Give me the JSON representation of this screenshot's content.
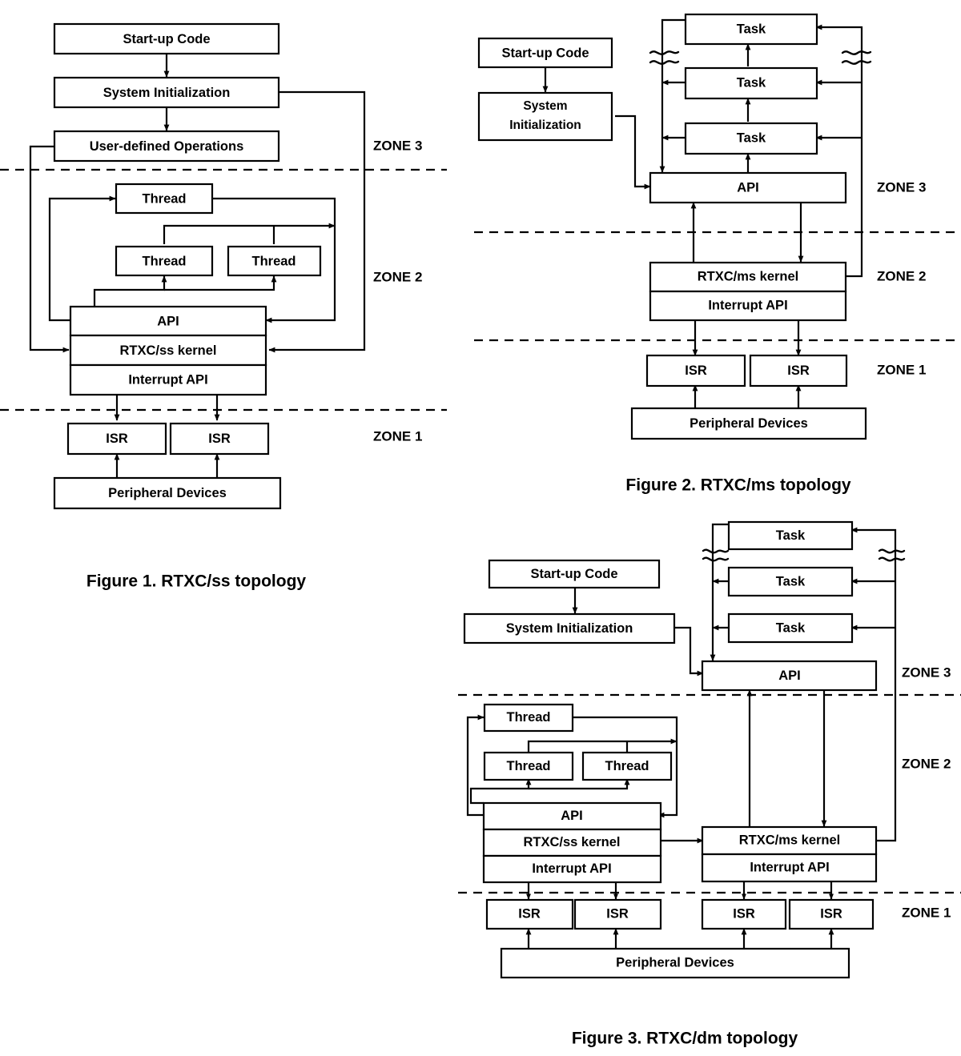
{
  "figures": [
    {
      "id": "figure-1",
      "caption": "Figure 1. RTXC/ss topology",
      "zones": [
        "ZONE 3",
        "ZONE 2",
        "ZONE 1"
      ],
      "boxes": [
        {
          "name": "startup-code",
          "label": "Start-up Code"
        },
        {
          "name": "system-initialization",
          "label": "System Initialization"
        },
        {
          "name": "user-defined-operations",
          "label": "User-defined Operations"
        },
        {
          "name": "thread-1",
          "label": "Thread"
        },
        {
          "name": "thread-2",
          "label": "Thread"
        },
        {
          "name": "thread-3",
          "label": "Thread"
        },
        {
          "name": "api",
          "label": "API"
        },
        {
          "name": "rtxc-ss-kernel",
          "label": "RTXC/ss kernel"
        },
        {
          "name": "interrupt-api",
          "label": "Interrupt API"
        },
        {
          "name": "isr-1",
          "label": "ISR"
        },
        {
          "name": "isr-2",
          "label": "ISR"
        },
        {
          "name": "peripheral-devices",
          "label": "Peripheral Devices"
        }
      ]
    },
    {
      "id": "figure-2",
      "caption": "Figure 2. RTXC/ms topology",
      "zones": [
        "ZONE 3",
        "ZONE 2",
        "ZONE 1"
      ],
      "boxes": [
        {
          "name": "startup-code",
          "label": "Start-up Code"
        },
        {
          "name": "system-initialization",
          "label": "System Initialization"
        },
        {
          "name": "task-1",
          "label": "Task"
        },
        {
          "name": "task-2",
          "label": "Task"
        },
        {
          "name": "task-3",
          "label": "Task"
        },
        {
          "name": "api",
          "label": "API"
        },
        {
          "name": "rtxc-ms-kernel",
          "label": "RTXC/ms kernel"
        },
        {
          "name": "interrupt-api",
          "label": "Interrupt API"
        },
        {
          "name": "isr-1",
          "label": "ISR"
        },
        {
          "name": "isr-2",
          "label": "ISR"
        },
        {
          "name": "peripheral-devices",
          "label": "Peripheral Devices"
        }
      ]
    },
    {
      "id": "figure-3",
      "caption": "Figure 3. RTXC/dm topology",
      "zones": [
        "ZONE 3",
        "ZONE 2",
        "ZONE 1"
      ],
      "boxes": [
        {
          "name": "startup-code",
          "label": "Start-up Code"
        },
        {
          "name": "system-initialization",
          "label": "System Initialization"
        },
        {
          "name": "task-1",
          "label": "Task"
        },
        {
          "name": "task-2",
          "label": "Task"
        },
        {
          "name": "task-3",
          "label": "Task"
        },
        {
          "name": "api-ms",
          "label": "API"
        },
        {
          "name": "thread-1",
          "label": "Thread"
        },
        {
          "name": "thread-2",
          "label": "Thread"
        },
        {
          "name": "thread-3",
          "label": "Thread"
        },
        {
          "name": "api-ss",
          "label": "API"
        },
        {
          "name": "rtxc-ss-kernel",
          "label": "RTXC/ss kernel"
        },
        {
          "name": "interrupt-api-ss",
          "label": "Interrupt API"
        },
        {
          "name": "rtxc-ms-kernel",
          "label": "RTXC/ms kernel"
        },
        {
          "name": "interrupt-api-ms",
          "label": "Interrupt API"
        },
        {
          "name": "isr-1",
          "label": "ISR"
        },
        {
          "name": "isr-2",
          "label": "ISR"
        },
        {
          "name": "isr-3",
          "label": "ISR"
        },
        {
          "name": "isr-4",
          "label": "ISR"
        },
        {
          "name": "peripheral-devices",
          "label": "Peripheral Devices"
        }
      ]
    }
  ],
  "colors": {
    "stroke": "#000000",
    "fill": "#ffffff",
    "text": "#000000"
  }
}
